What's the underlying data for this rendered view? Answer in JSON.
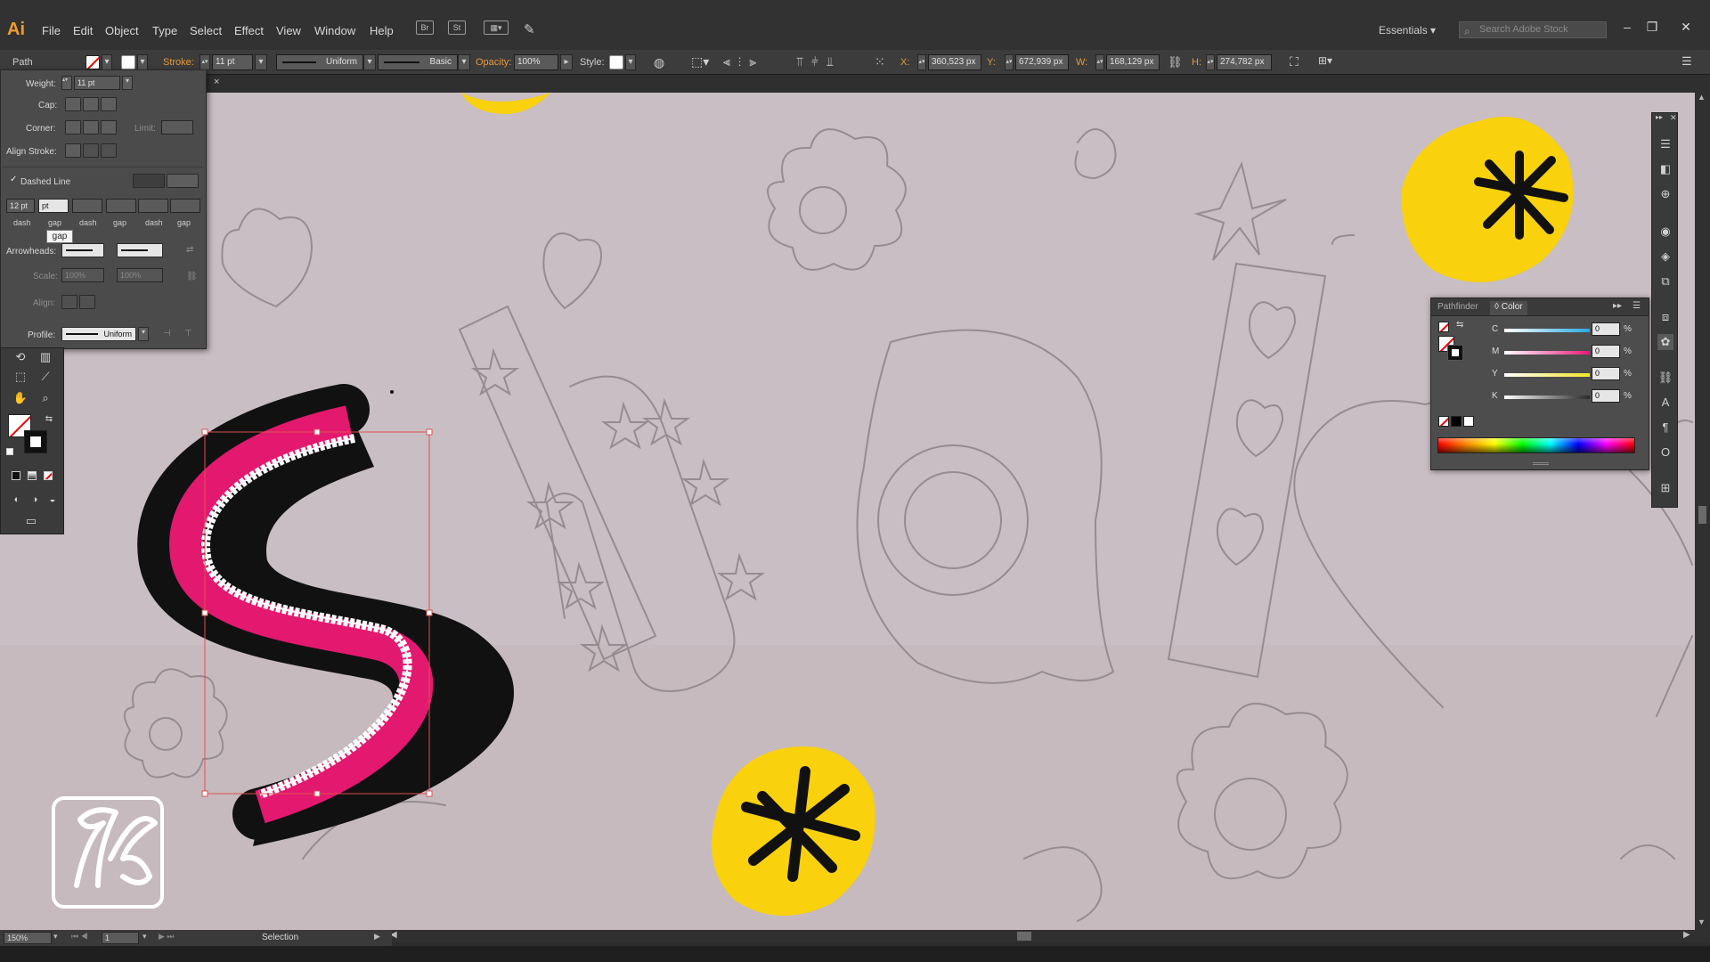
{
  "app": {
    "logo": "Ai"
  },
  "menu": [
    "File",
    "Edit",
    "Object",
    "Type",
    "Select",
    "Effect",
    "View",
    "Window",
    "Help"
  ],
  "menu_icons": [
    "Br",
    "St"
  ],
  "workspace": "Essentials",
  "search": {
    "placeholder": "Search Adobe Stock"
  },
  "control_bar": {
    "object_type": "Path",
    "stroke_label": "Stroke:",
    "stroke_weight": "11 pt",
    "profile": "Uniform",
    "brush": "Basic",
    "opacity_label": "Opacity:",
    "opacity": "100%",
    "style_label": "Style:",
    "x_label": "X:",
    "x": "360,523 px",
    "y_label": "Y:",
    "y": "672,939 px",
    "w_label": "W:",
    "w": "168,129 px",
    "h_label": "H:",
    "h": "274,782 px"
  },
  "stroke_panel": {
    "weight_label": "Weight:",
    "weight": "11 pt",
    "cap_label": "Cap:",
    "corner_label": "Corner:",
    "limit_label": "Limit:",
    "align_label": "Align Stroke:",
    "dashed_label": "Dashed Line",
    "dashed_checked": true,
    "dash_values": [
      "12 pt",
      "pt",
      "",
      "",
      "",
      ""
    ],
    "dash_captions": [
      "dash",
      "gap",
      "dash",
      "gap",
      "dash",
      "gap"
    ],
    "tooltip": "gap",
    "arrowheads_label": "Arrowheads:",
    "scale_label": "Scale:",
    "scale_1": "100%",
    "scale_2": "100%",
    "align_arrow_label": "Align:",
    "profile_label": "Profile:",
    "profile": "Uniform"
  },
  "color_panel": {
    "tabs": [
      "Pathfinder",
      "Color"
    ],
    "active_tab": "Color",
    "channels": [
      {
        "label": "C",
        "value": "0",
        "color": "#27a9e1"
      },
      {
        "label": "M",
        "value": "0",
        "color": "#e6197b"
      },
      {
        "label": "Y",
        "value": "0",
        "color": "#f5e625"
      },
      {
        "label": "K",
        "value": "0",
        "color": "#2a2a2a"
      }
    ],
    "pct": "%"
  },
  "status_bar": {
    "zoom": "150%",
    "artboard": "1",
    "tool": "Selection"
  },
  "colors": {
    "pink": "#e3186f",
    "yellow": "#f9d10c",
    "canvas": "#c9bec3",
    "selection": "#e05050"
  }
}
